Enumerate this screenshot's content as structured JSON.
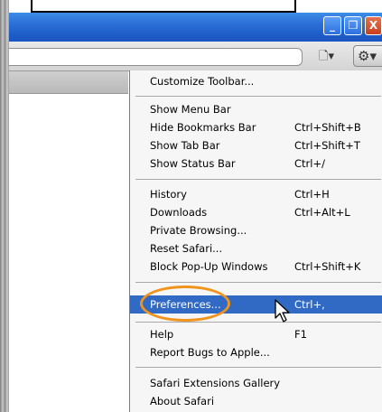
{
  "menu": {
    "customize_toolbar": "Customize Toolbar...",
    "show_menu_bar": "Show Menu Bar",
    "hide_bookmarks_bar": "Hide Bookmarks Bar",
    "hide_bookmarks_bar_key": "Ctrl+Shift+B",
    "show_tab_bar": "Show Tab Bar",
    "show_tab_bar_key": "Ctrl+Shift+T",
    "show_status_bar": "Show Status Bar",
    "show_status_bar_key": "Ctrl+/",
    "history": "History",
    "history_key": "Ctrl+H",
    "downloads": "Downloads",
    "downloads_key": "Ctrl+Alt+L",
    "private_browsing": "Private Browsing...",
    "reset_safari": "Reset Safari...",
    "block_popups": "Block Pop-Up Windows",
    "block_popups_key": "Ctrl+Shift+K",
    "preferences": "Preferences...",
    "preferences_key": "Ctrl+,",
    "help": "Help",
    "help_key": "F1",
    "report_bugs": "Report Bugs to Apple...",
    "extensions_gallery": "Safari Extensions Gallery",
    "about_safari": "About Safari"
  },
  "window_buttons": {
    "minimize": "_",
    "maximize": "❐",
    "close": "X"
  },
  "icons": {
    "page": "page-menu-icon",
    "gear": "gear-icon"
  },
  "colors": {
    "highlight": "#316ac5",
    "annotation_ring": "#f0941e",
    "titlebar": "#2b6fd6"
  }
}
